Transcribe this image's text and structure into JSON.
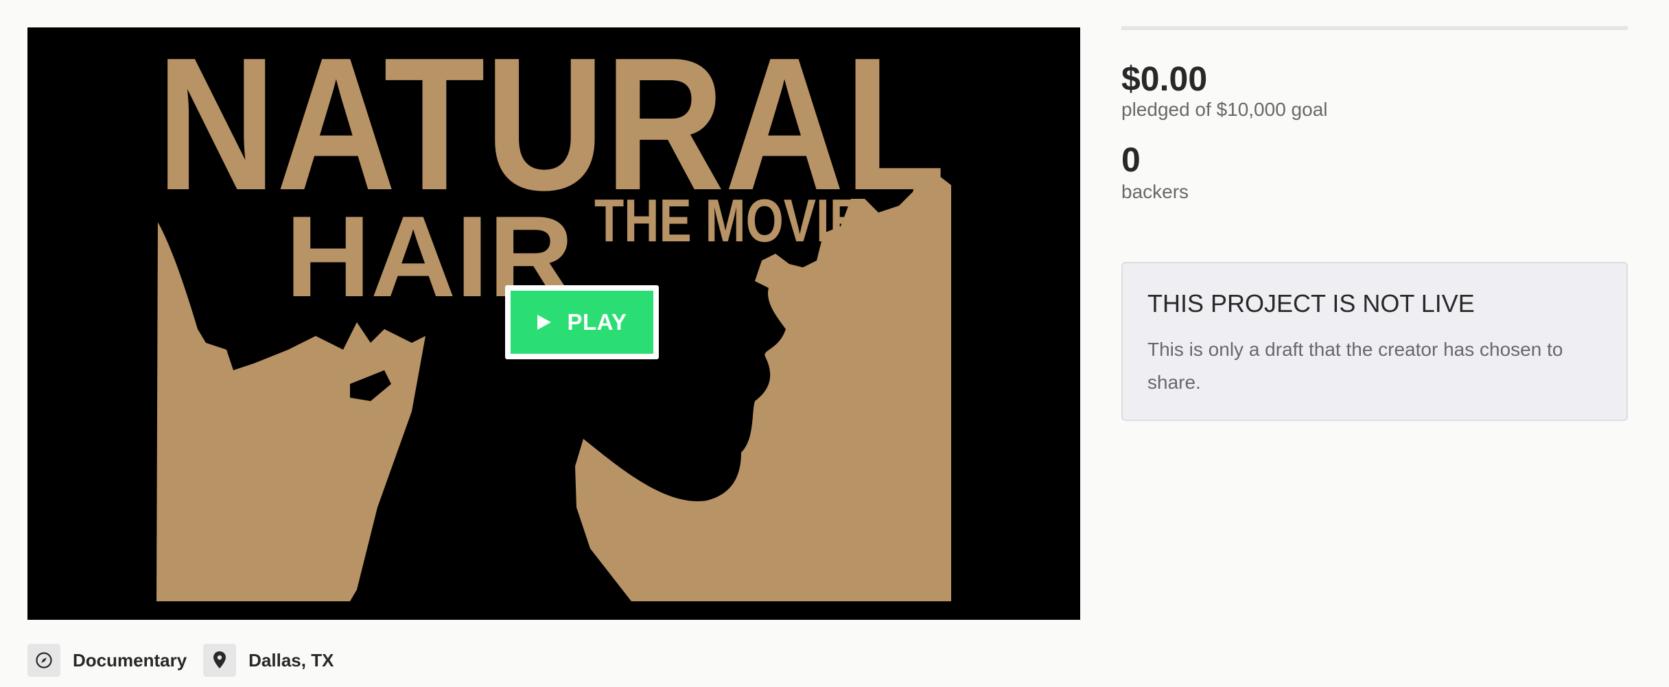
{
  "video": {
    "title_line1": "NATURAL",
    "title_line2": "HAIR",
    "title_line3": "THE MOVIE",
    "play_label": "PLAY",
    "art_color": "#b89366"
  },
  "funding": {
    "pledged_amount": "$0.00",
    "pledged_goal_text": "pledged of $10,000 goal",
    "backers_count": "0",
    "backers_label": "backers",
    "progress_fraction": 0
  },
  "notice": {
    "title": "THIS PROJECT IS NOT LIVE",
    "body": "This is only a draft that the creator has chosen to share."
  },
  "meta": {
    "category": "Documentary",
    "category_icon": "compass-icon",
    "location": "Dallas, TX",
    "location_icon": "location-pin-icon"
  },
  "colors": {
    "play_button": "#2bde73",
    "notice_bg": "#efeff3",
    "page_bg": "#fafaf8"
  }
}
